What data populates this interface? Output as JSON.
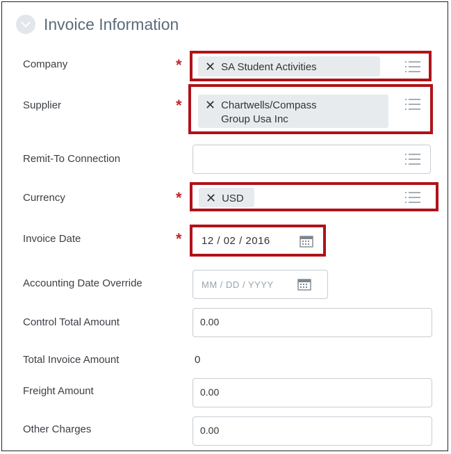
{
  "section": {
    "title": "Invoice Information"
  },
  "fields": {
    "company": {
      "label": "Company",
      "value": "SA Student Activities"
    },
    "supplier": {
      "label": "Supplier",
      "value_line1": "Chartwells/Compass",
      "value_line2": "Group Usa Inc"
    },
    "remit_to": {
      "label": "Remit-To Connection",
      "value": ""
    },
    "currency": {
      "label": "Currency",
      "value": "USD"
    },
    "invoice_date": {
      "label": "Invoice Date",
      "mm": "12",
      "dd": "02",
      "yyyy": "2016",
      "sep": "/"
    },
    "accounting_date": {
      "label": "Accounting Date Override",
      "mm": "MM",
      "dd": "DD",
      "yyyy": "YYYY",
      "sep": "/"
    },
    "control_total": {
      "label": "Control Total Amount",
      "value": "0.00"
    },
    "total_invoice": {
      "label": "Total Invoice Amount",
      "value": "0"
    },
    "freight": {
      "label": "Freight Amount",
      "value": "0.00"
    },
    "other_charges": {
      "label": "Other Charges",
      "value": "0.00"
    }
  },
  "required_marker": "*",
  "remove_glyph": "✕",
  "icons": {
    "list": "list-icon",
    "calendar": "calendar-icon",
    "chevron": "chevron-down-icon"
  },
  "colors": {
    "required": "#c1272d",
    "highlight": "#b0121a",
    "pill_bg": "#e8ebee"
  }
}
